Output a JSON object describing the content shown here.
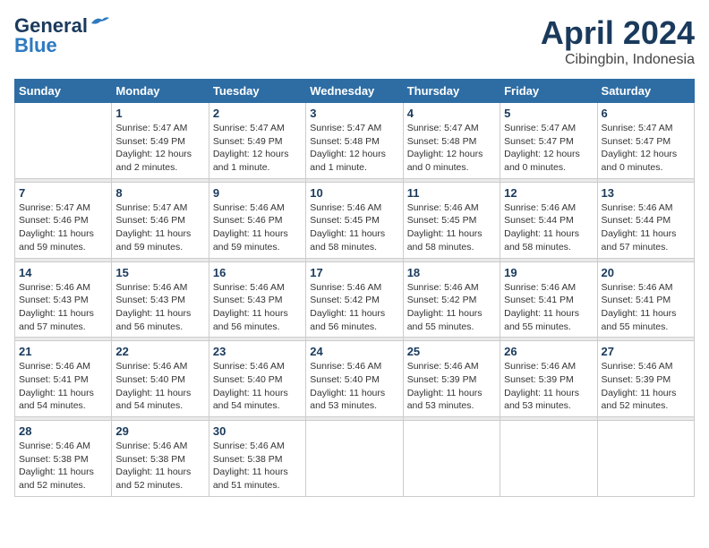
{
  "header": {
    "logo_line1": "General",
    "logo_line2": "Blue",
    "title": "April 2024",
    "subtitle": "Cibingbin, Indonesia"
  },
  "days_of_week": [
    "Sunday",
    "Monday",
    "Tuesday",
    "Wednesday",
    "Thursday",
    "Friday",
    "Saturday"
  ],
  "weeks": [
    [
      {
        "day": "",
        "info": ""
      },
      {
        "day": "1",
        "info": "Sunrise: 5:47 AM\nSunset: 5:49 PM\nDaylight: 12 hours\nand 2 minutes."
      },
      {
        "day": "2",
        "info": "Sunrise: 5:47 AM\nSunset: 5:49 PM\nDaylight: 12 hours\nand 1 minute."
      },
      {
        "day": "3",
        "info": "Sunrise: 5:47 AM\nSunset: 5:48 PM\nDaylight: 12 hours\nand 1 minute."
      },
      {
        "day": "4",
        "info": "Sunrise: 5:47 AM\nSunset: 5:48 PM\nDaylight: 12 hours\nand 0 minutes."
      },
      {
        "day": "5",
        "info": "Sunrise: 5:47 AM\nSunset: 5:47 PM\nDaylight: 12 hours\nand 0 minutes."
      },
      {
        "day": "6",
        "info": "Sunrise: 5:47 AM\nSunset: 5:47 PM\nDaylight: 12 hours\nand 0 minutes."
      }
    ],
    [
      {
        "day": "7",
        "info": "Sunrise: 5:47 AM\nSunset: 5:46 PM\nDaylight: 11 hours\nand 59 minutes."
      },
      {
        "day": "8",
        "info": "Sunrise: 5:47 AM\nSunset: 5:46 PM\nDaylight: 11 hours\nand 59 minutes."
      },
      {
        "day": "9",
        "info": "Sunrise: 5:46 AM\nSunset: 5:46 PM\nDaylight: 11 hours\nand 59 minutes."
      },
      {
        "day": "10",
        "info": "Sunrise: 5:46 AM\nSunset: 5:45 PM\nDaylight: 11 hours\nand 58 minutes."
      },
      {
        "day": "11",
        "info": "Sunrise: 5:46 AM\nSunset: 5:45 PM\nDaylight: 11 hours\nand 58 minutes."
      },
      {
        "day": "12",
        "info": "Sunrise: 5:46 AM\nSunset: 5:44 PM\nDaylight: 11 hours\nand 58 minutes."
      },
      {
        "day": "13",
        "info": "Sunrise: 5:46 AM\nSunset: 5:44 PM\nDaylight: 11 hours\nand 57 minutes."
      }
    ],
    [
      {
        "day": "14",
        "info": "Sunrise: 5:46 AM\nSunset: 5:43 PM\nDaylight: 11 hours\nand 57 minutes."
      },
      {
        "day": "15",
        "info": "Sunrise: 5:46 AM\nSunset: 5:43 PM\nDaylight: 11 hours\nand 56 minutes."
      },
      {
        "day": "16",
        "info": "Sunrise: 5:46 AM\nSunset: 5:43 PM\nDaylight: 11 hours\nand 56 minutes."
      },
      {
        "day": "17",
        "info": "Sunrise: 5:46 AM\nSunset: 5:42 PM\nDaylight: 11 hours\nand 56 minutes."
      },
      {
        "day": "18",
        "info": "Sunrise: 5:46 AM\nSunset: 5:42 PM\nDaylight: 11 hours\nand 55 minutes."
      },
      {
        "day": "19",
        "info": "Sunrise: 5:46 AM\nSunset: 5:41 PM\nDaylight: 11 hours\nand 55 minutes."
      },
      {
        "day": "20",
        "info": "Sunrise: 5:46 AM\nSunset: 5:41 PM\nDaylight: 11 hours\nand 55 minutes."
      }
    ],
    [
      {
        "day": "21",
        "info": "Sunrise: 5:46 AM\nSunset: 5:41 PM\nDaylight: 11 hours\nand 54 minutes."
      },
      {
        "day": "22",
        "info": "Sunrise: 5:46 AM\nSunset: 5:40 PM\nDaylight: 11 hours\nand 54 minutes."
      },
      {
        "day": "23",
        "info": "Sunrise: 5:46 AM\nSunset: 5:40 PM\nDaylight: 11 hours\nand 54 minutes."
      },
      {
        "day": "24",
        "info": "Sunrise: 5:46 AM\nSunset: 5:40 PM\nDaylight: 11 hours\nand 53 minutes."
      },
      {
        "day": "25",
        "info": "Sunrise: 5:46 AM\nSunset: 5:39 PM\nDaylight: 11 hours\nand 53 minutes."
      },
      {
        "day": "26",
        "info": "Sunrise: 5:46 AM\nSunset: 5:39 PM\nDaylight: 11 hours\nand 53 minutes."
      },
      {
        "day": "27",
        "info": "Sunrise: 5:46 AM\nSunset: 5:39 PM\nDaylight: 11 hours\nand 52 minutes."
      }
    ],
    [
      {
        "day": "28",
        "info": "Sunrise: 5:46 AM\nSunset: 5:38 PM\nDaylight: 11 hours\nand 52 minutes."
      },
      {
        "day": "29",
        "info": "Sunrise: 5:46 AM\nSunset: 5:38 PM\nDaylight: 11 hours\nand 52 minutes."
      },
      {
        "day": "30",
        "info": "Sunrise: 5:46 AM\nSunset: 5:38 PM\nDaylight: 11 hours\nand 51 minutes."
      },
      {
        "day": "",
        "info": ""
      },
      {
        "day": "",
        "info": ""
      },
      {
        "day": "",
        "info": ""
      },
      {
        "day": "",
        "info": ""
      }
    ]
  ]
}
